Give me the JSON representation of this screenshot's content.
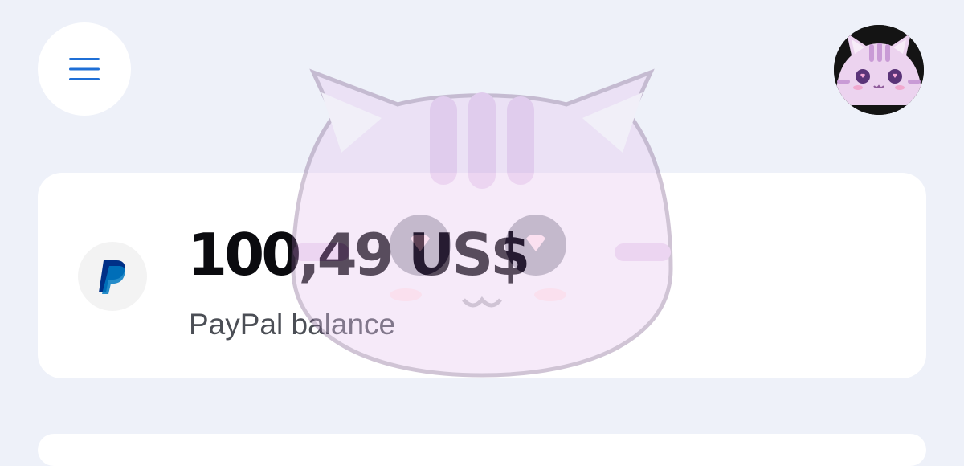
{
  "header": {
    "menu_icon": "hamburger-menu-icon",
    "avatar_icon": "cat-avatar-icon"
  },
  "balance_card": {
    "amount": "100,49 US$",
    "label": "PayPal balance",
    "logo_icon": "paypal-logo-icon"
  },
  "colors": {
    "page_background": "#eef1f9",
    "card_background": "#ffffff",
    "menu_icon": "#1f6fd6",
    "paypal_dark": "#003087",
    "paypal_light": "#0079c1",
    "amount_text": "#0b0b0f",
    "label_text": "#4b4e55"
  }
}
